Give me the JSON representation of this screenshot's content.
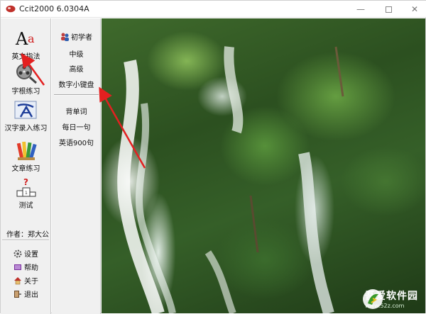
{
  "window": {
    "title": "Ccit2000 6.0304A",
    "minimize_glyph": "—",
    "close_glyph": "✕"
  },
  "left_panel": {
    "tools": [
      {
        "id": "english-fingering",
        "label": "英文指法",
        "icon": "typography-aa-icon"
      },
      {
        "id": "radical-practice",
        "label": "字根练习",
        "icon": "film-reel-icon"
      },
      {
        "id": "chinese-input",
        "label": "汉字录入练习",
        "icon": "calligraphy-icon"
      },
      {
        "id": "article-practice",
        "label": "文章练习",
        "icon": "pencils-icon"
      },
      {
        "id": "test",
        "label": "测试",
        "icon": "podium-question-icon"
      }
    ],
    "author": "作者：郑大公",
    "options": [
      {
        "label": "设置",
        "icon": "gear-icon"
      },
      {
        "label": "帮助",
        "icon": "help-book-icon"
      },
      {
        "label": "关于",
        "icon": "house-icon"
      },
      {
        "label": "退出",
        "icon": "exit-icon"
      }
    ]
  },
  "middle_panel": {
    "levels": [
      {
        "label": "初学者",
        "icon": "users-icon"
      },
      {
        "label": "中级"
      },
      {
        "label": "高级"
      },
      {
        "label": "数字小键盘"
      }
    ],
    "extras": [
      {
        "label": "背单词"
      },
      {
        "label": "每日一句"
      },
      {
        "label": "英语900句"
      }
    ]
  },
  "watermark": {
    "name": "吾爱软件园",
    "url": "www.52z.com"
  },
  "colors": {
    "panel_bg": "#f0f0f0",
    "annotation_arrow": "#e32020",
    "title_icon": "#c0312b"
  }
}
